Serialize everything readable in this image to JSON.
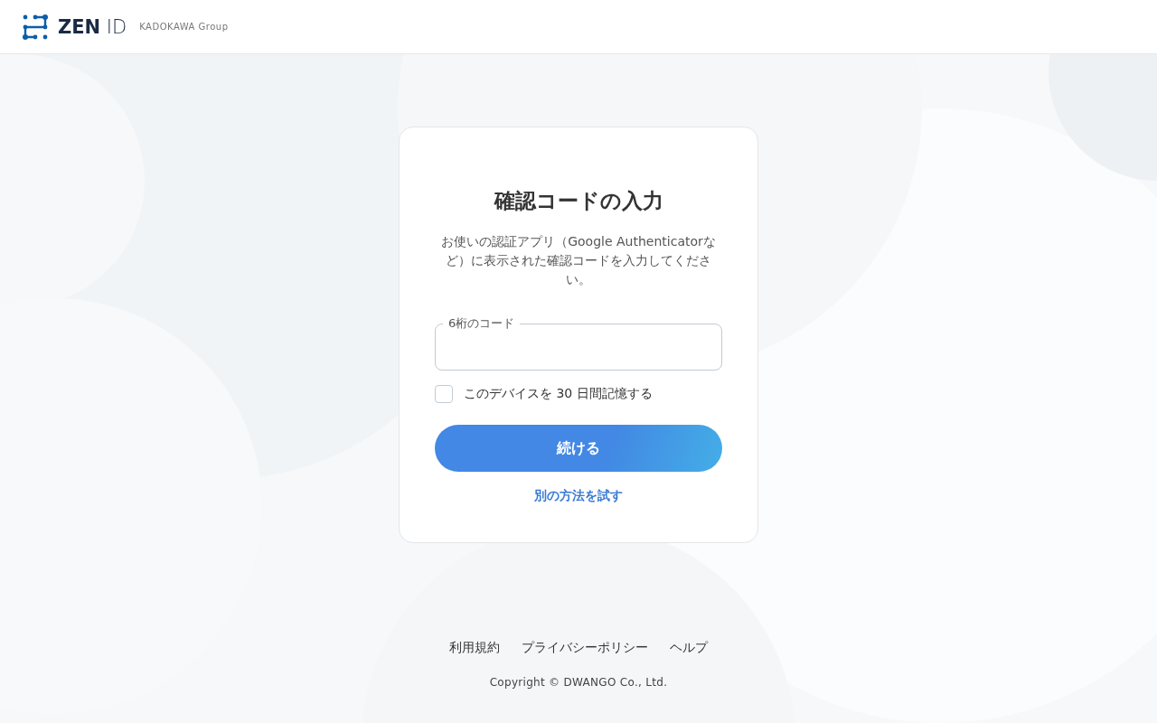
{
  "header": {
    "logo_text": "**ZEN** ID",
    "group": "KADOKAWA Group"
  },
  "card": {
    "title": "確認コードの入力",
    "description": "お使いの認証アプリ（Google Authenticatorなど）に表示された確認コードを入力してください。",
    "code_field": {
      "label": "6桁のコード"
    },
    "remember": {
      "label": "このデバイスを 30 日間記憶する",
      "checked": false
    },
    "submit": "続ける",
    "alt_link": "別の方法を試す"
  },
  "footer": {
    "links": [
      "利用規約",
      "プライバシーポリシー",
      "ヘルプ"
    ],
    "copyright": "Copyright © DWANGO Co., Ltd."
  }
}
